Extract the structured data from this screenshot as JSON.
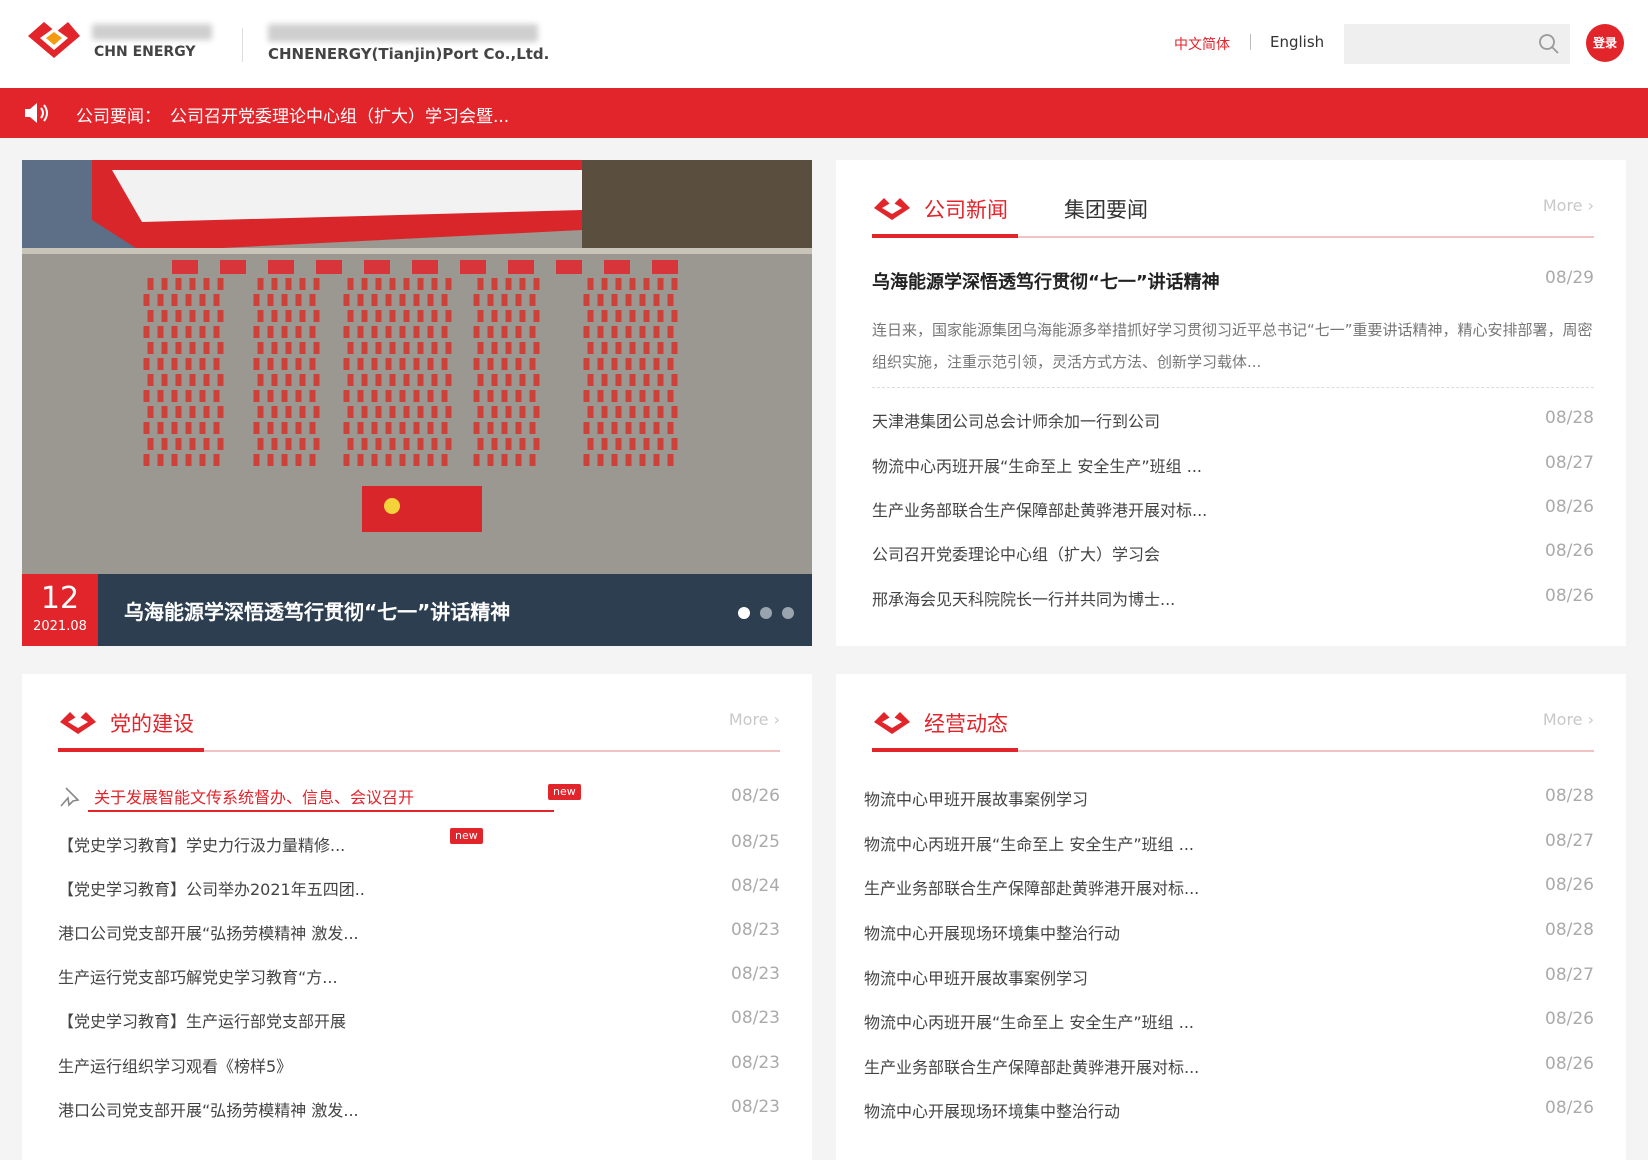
{
  "header": {
    "logo_cn": "国家能源集团",
    "logo_en": "CHN ENERGY",
    "company_cn": "国能（天津）港务有限责任公司",
    "company_en": "CHNENERGY(Tianjin)Port Co.,Ltd.",
    "lang_cn": "中文简体",
    "lang_en": "English",
    "search_placeholder": "",
    "login_label": "登录"
  },
  "notice": {
    "label": "公司要闻：",
    "text": "公司召开党委理论中心组（扩大）学习会暨..."
  },
  "carousel": {
    "day": "12",
    "year_month": "2021.08",
    "title": "乌海能源学深悟透笃行贯彻“七一”讲话精神",
    "slides": 3,
    "active_slide": 1
  },
  "company_news": {
    "tab_active": "公司新闻",
    "tab_inactive": "集团要闻",
    "more": "More ›",
    "featured": {
      "title": "乌海能源学深悟透笃行贯彻“七一”讲话精神",
      "date": "08/29",
      "summary": "连日来，国家能源集团乌海能源多举措抓好学习贯彻习近平总书记“七一”重要讲话精神，精心安排部署，周密组织实施，注重示范引领，灵活方式方法、创新学习载体..."
    },
    "items": [
      {
        "title": "天津港集团公司总会计师余加一行到公司",
        "date": "08/28"
      },
      {
        "title": "物流中心丙班开展“生命至上 安全生产”班组 ...",
        "date": "08/27"
      },
      {
        "title": "生产业务部联合生产保障部赴黄骅港开展对标...",
        "date": "08/26"
      },
      {
        "title": "公司召开党委理论中心组（扩大）学习会",
        "date": "08/26"
      },
      {
        "title": "邢承海会见天科院院长一行并共同为博士...",
        "date": "08/26"
      }
    ]
  },
  "party": {
    "title": "党的建设",
    "more": "More ›",
    "highlight": {
      "title": "关于发展智能文传系统督办、信息、会议召开",
      "badge": "new",
      "date": "08/26"
    },
    "items": [
      {
        "title": "【党史学习教育】学史力行汲力量精修...",
        "badge": "new",
        "date": "08/25"
      },
      {
        "title": "【党史学习教育】公司举办2021年五四团..",
        "date": "08/24"
      },
      {
        "title": "港口公司党支部开展“弘扬劳模精神 激发...",
        "date": "08/23"
      },
      {
        "title": "生产运行党支部巧解党史学习教育“方...",
        "date": "08/23"
      },
      {
        "title": "【党史学习教育】生产运行部党支部开展",
        "date": "08/23"
      },
      {
        "title": "生产运行组织学习观看《榜样5》",
        "date": "08/23"
      },
      {
        "title": "港口公司党支部开展“弘扬劳模精神 激发...",
        "date": "08/23"
      }
    ]
  },
  "operations": {
    "title": "经营动态",
    "more": "More ›",
    "items": [
      {
        "title": "物流中心甲班开展故事案例学习",
        "date": "08/28"
      },
      {
        "title": "物流中心丙班开展“生命至上 安全生产”班组 ...",
        "date": "08/27"
      },
      {
        "title": "生产业务部联合生产保障部赴黄骅港开展对标...",
        "date": "08/26"
      },
      {
        "title": "物流中心开展现场环境集中整治行动",
        "date": "08/28"
      },
      {
        "title": "物流中心甲班开展故事案例学习",
        "date": "08/27"
      },
      {
        "title": "物流中心丙班开展“生命至上 安全生产”班组 ...",
        "date": "08/26"
      },
      {
        "title": "生产业务部联合生产保障部赴黄骅港开展对标...",
        "date": "08/26"
      },
      {
        "title": "物流中心开展现场环境集中整治行动",
        "date": "08/26"
      }
    ]
  },
  "colors": {
    "brand_red": "#e2242b",
    "notice_bg": "#e2242b",
    "caption_bg": "#2c3e50"
  }
}
